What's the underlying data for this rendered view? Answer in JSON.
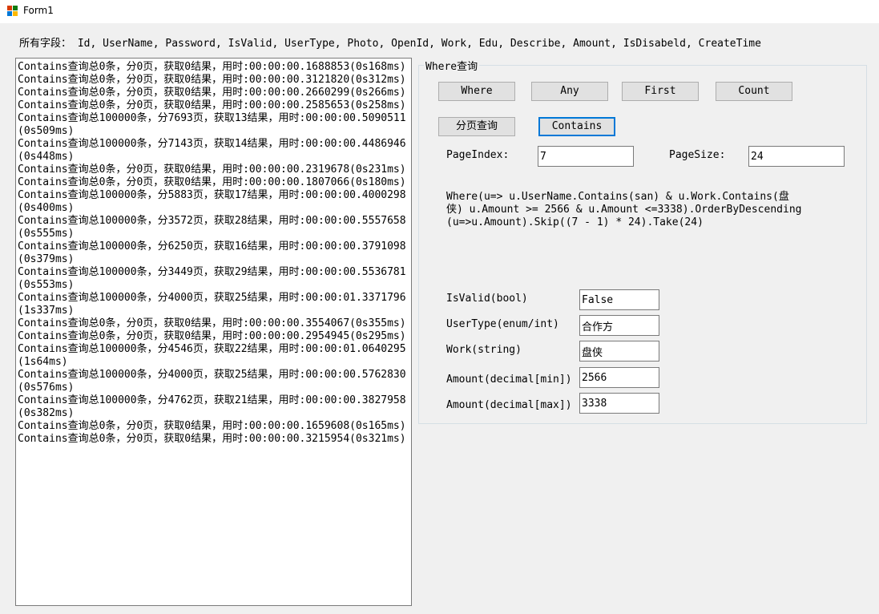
{
  "window": {
    "title": "Form1"
  },
  "fields_line": "所有字段： Id, UserName, Password, IsValid, UserType, Photo, OpenId, Work, Edu, Describe, Amount, IsDisabeld, CreateTime",
  "log": [
    "Contains查询总0条，分0页，获取0结果，用时:00:00:00.1688853(0s168ms)",
    "Contains查询总0条，分0页，获取0结果，用时:00:00:00.3121820(0s312ms)",
    "Contains查询总0条，分0页，获取0结果，用时:00:00:00.2660299(0s266ms)",
    "Contains查询总0条，分0页，获取0结果，用时:00:00:00.2585653(0s258ms)",
    "Contains查询总100000条，分7693页，获取13结果，用时:00:00:00.5090511(0s509ms)",
    "Contains查询总100000条，分7143页，获取14结果，用时:00:00:00.4486946(0s448ms)",
    "Contains查询总0条，分0页，获取0结果，用时:00:00:00.2319678(0s231ms)",
    "Contains查询总0条，分0页，获取0结果，用时:00:00:00.1807066(0s180ms)",
    "Contains查询总100000条，分5883页，获取17结果，用时:00:00:00.4000298(0s400ms)",
    "Contains查询总100000条，分3572页，获取28结果，用时:00:00:00.5557658(0s555ms)",
    "Contains查询总100000条，分6250页，获取16结果，用时:00:00:00.3791098(0s379ms)",
    "Contains查询总100000条，分3449页，获取29结果，用时:00:00:00.5536781(0s553ms)",
    "Contains查询总100000条，分4000页，获取25结果，用时:00:00:01.3371796(1s337ms)",
    "Contains查询总0条，分0页，获取0结果，用时:00:00:00.3554067(0s355ms)",
    "Contains查询总0条，分0页，获取0结果，用时:00:00:00.2954945(0s295ms)",
    "Contains查询总100000条，分4546页，获取22结果，用时:00:00:01.0640295(1s64ms)",
    "Contains查询总100000条，分4000页，获取25结果，用时:00:00:00.5762830(0s576ms)",
    "Contains查询总100000条，分4762页，获取21结果，用时:00:00:00.3827958(0s382ms)",
    "Contains查询总0条，分0页，获取0结果，用时:00:00:00.1659608(0s165ms)",
    "Contains查询总0条，分0页，获取0结果，用时:00:00:00.3215954(0s321ms)"
  ],
  "group": {
    "title": "Where查询",
    "buttons": {
      "where": "Where",
      "any": "Any",
      "first": "First",
      "count": "Count",
      "paging": "分页查询",
      "contains": "Contains"
    },
    "page_index_label": "PageIndex:",
    "page_index_value": "7",
    "page_size_label": "PageSize:",
    "page_size_value": "24",
    "expression": "Where(u=> u.UserName.Contains(san) & u.Work.Contains(盘侠) u.Amount >= 2566 & u.Amount <=3338).OrderByDescending(u=>u.Amount).Skip((7 - 1) * 24).Take(24)",
    "filters": [
      {
        "label": "IsValid(bool)",
        "value": "False"
      },
      {
        "label": "UserType(enum/int)",
        "value": "合作方"
      },
      {
        "label": "Work(string)",
        "value": "盘侠"
      },
      {
        "label": "Amount(decimal[min])",
        "value": "2566"
      },
      {
        "label": "Amount(decimal[max])",
        "value": "3338"
      }
    ]
  },
  "colors": {
    "window_bg": "#f0f0f0",
    "button_bg": "#e1e1e1",
    "focus_border": "#0078d7"
  }
}
